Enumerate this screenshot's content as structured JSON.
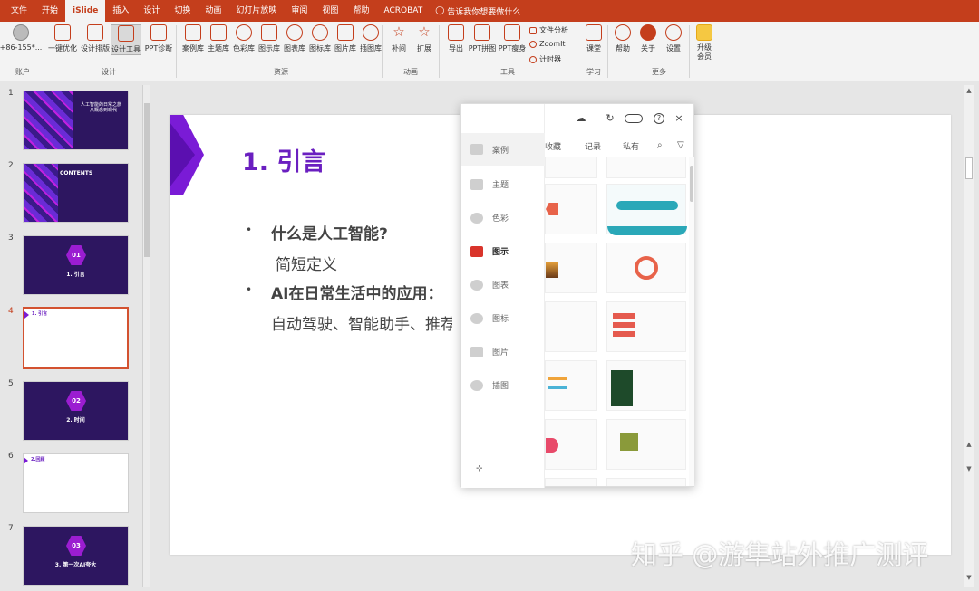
{
  "ribbon_tabs": [
    "文件",
    "开始",
    "iSlide",
    "插入",
    "设计",
    "切换",
    "动画",
    "幻灯片放映",
    "审阅",
    "视图",
    "帮助",
    "ACROBAT"
  ],
  "tell_me": "告诉我你想要做什么",
  "ribbon": {
    "account_label": "+86-155*...",
    "group_account": "账户",
    "group_design": "设计",
    "group_resources": "资源",
    "group_animation": "动画",
    "group_tools": "工具",
    "group_learn": "学习",
    "group_more": "更多",
    "buttons": {
      "one_click": "一键优化",
      "design_layout": "设计排版",
      "design_tools": "设计工具",
      "ppt_diag": "PPT诊断",
      "case_lib": "案例库",
      "theme_lib": "主题库",
      "color_lib": "色彩库",
      "diagram_lib": "图示库",
      "chart_lib": "图表库",
      "icon_lib": "图标库",
      "image_lib": "图片库",
      "illus_lib": "插图库",
      "tween": "补间",
      "extend": "扩展",
      "export": "导出",
      "ppt_puzzle": "PPT拼图",
      "ppt_slim": "PPT瘦身",
      "file_analysis": "文件分析",
      "zoomit": "ZoomIt",
      "timer": "计时器",
      "classroom": "课堂",
      "help": "帮助",
      "about": "关于",
      "settings": "设置",
      "upgrade": "升级会员"
    }
  },
  "thumbnails": [
    {
      "num": "1",
      "title": "人工智能的日常之旅——从概念到现代"
    },
    {
      "num": "2",
      "title": "CONTENTS"
    },
    {
      "num": "3",
      "hex": "01",
      "caption": "1. 引言"
    },
    {
      "num": "4",
      "title": "1. 引言"
    },
    {
      "num": "5",
      "hex": "02",
      "caption": "2. 时间"
    },
    {
      "num": "6",
      "title": "2.回顾"
    },
    {
      "num": "7",
      "hex": "03",
      "caption": "3. 第一次AI夸大"
    }
  ],
  "slide": {
    "title": "1. 引言",
    "bullet1": "什么是人工智能?",
    "sub1": "简短定义",
    "bullet2": "AI在日常生活中的应用：",
    "sub2": "自动驾驶、智能助手、推荐"
  },
  "panel": {
    "side_items": [
      "案例",
      "主题",
      "色彩",
      "图示",
      "图表",
      "图标",
      "图片",
      "插图"
    ],
    "tabs": [
      "收藏",
      "记录",
      "私有"
    ]
  },
  "watermark": "知乎 @游隼站外推广测评"
}
